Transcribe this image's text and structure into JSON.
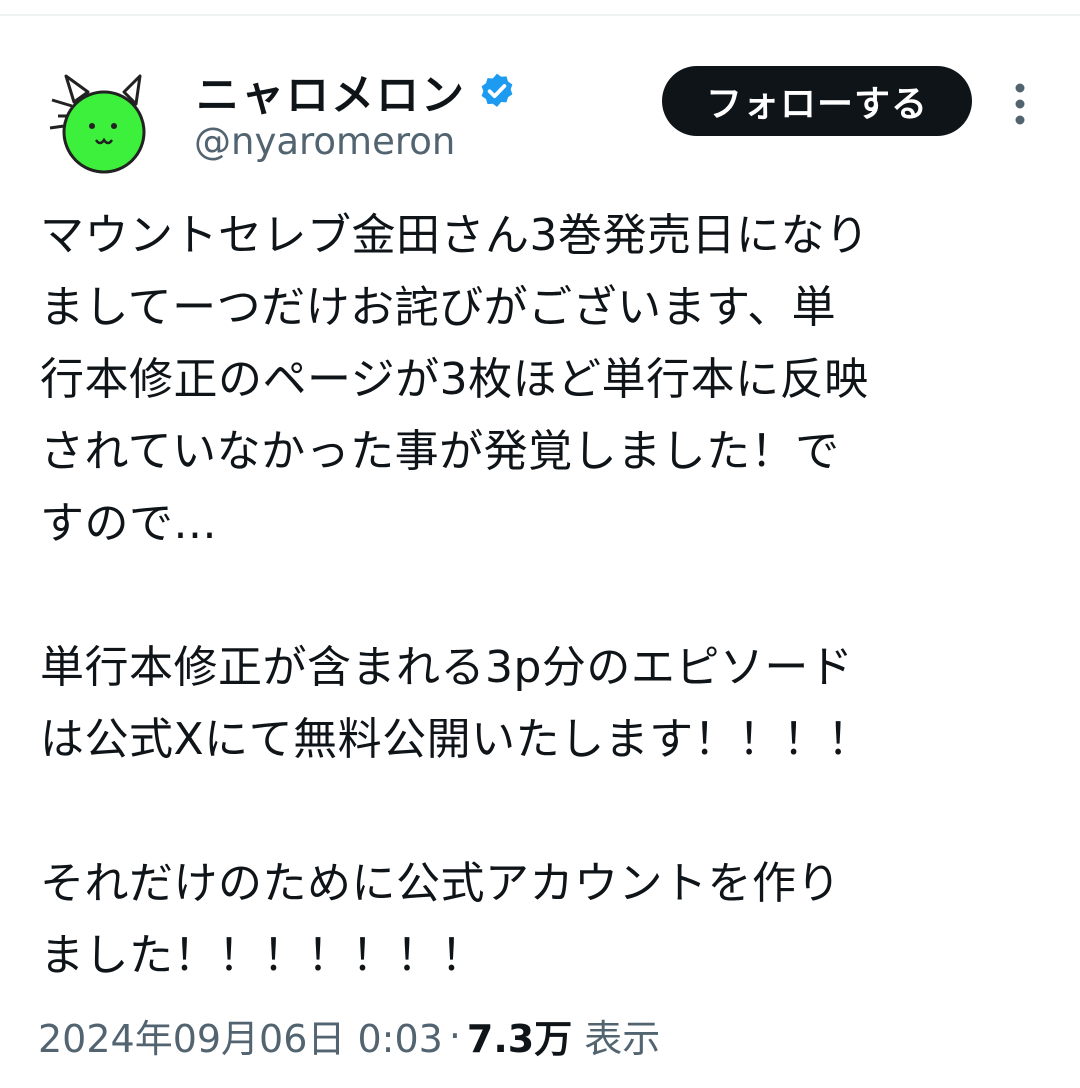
{
  "header": {
    "display_name": "ニャロメロン",
    "handle": "@nyaromeron",
    "follow_label": "フォローする",
    "verified": true
  },
  "tweet": {
    "paragraphs": [
      {
        "lines": [
          "マウントセレブ金田さん3巻発売日になり",
          "ましてーつだけお詫びがございます、単",
          "行本修正のページが3枚ほど単行本に反映",
          "されていなかった事が発覚しました！で",
          "すので..."
        ]
      },
      {
        "lines": [
          "単行本修正が含まれる3p分のエピソード",
          "は公式Xにて無料公開いたします！！！！"
        ]
      },
      {
        "lines": [
          "それだけのために公式アカウントを作り",
          "ました！！！！！！！"
        ]
      }
    ]
  },
  "meta": {
    "datetime": "2024年09月06日 0:03",
    "separator": "·",
    "views_count": "7.3万",
    "views_label": "表示"
  },
  "colors": {
    "text": "#0f1419",
    "secondary": "#536471",
    "verified_blue": "#1d9bf0",
    "avatar_green": "#3cf03c",
    "divider": "#eff3f4"
  },
  "icons": {
    "avatar": "green-cat-icon",
    "verified": "verified-badge-icon",
    "more": "more-vertical-icon"
  }
}
